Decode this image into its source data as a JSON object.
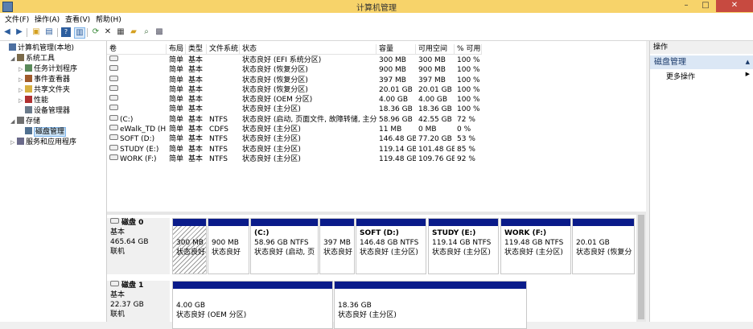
{
  "window": {
    "title": "计算机管理",
    "min": "–",
    "max": "□",
    "close": "✕"
  },
  "menu": [
    "文件(F)",
    "操作(A)",
    "查看(V)",
    "帮助(H)"
  ],
  "toolbar": [
    "back-icon",
    "forward-icon",
    "folder-up-icon",
    "show-hide-tree-icon",
    "help-icon",
    "view-icon",
    "refresh-icon",
    "delete-icon",
    "properties-icon",
    "open-folder-icon",
    "search-icon",
    "settings-icon"
  ],
  "tree": [
    {
      "label": "计算机管理(本地)",
      "level": 0,
      "arrow": "",
      "icon": "computer-icon",
      "color": "#4d6fa0"
    },
    {
      "label": "系统工具",
      "level": 1,
      "arrow": "◢",
      "icon": "tools-icon",
      "color": "#7a6a4a"
    },
    {
      "label": "任务计划程序",
      "level": 2,
      "arrow": "▷",
      "icon": "clock-icon",
      "color": "#5a8a5a"
    },
    {
      "label": "事件查看器",
      "level": 2,
      "arrow": "▷",
      "icon": "event-icon",
      "color": "#a05a2a"
    },
    {
      "label": "共享文件夹",
      "level": 2,
      "arrow": "▷",
      "icon": "share-icon",
      "color": "#d8b040"
    },
    {
      "label": "性能",
      "level": 2,
      "arrow": "▷",
      "icon": "performance-icon",
      "color": "#b03030"
    },
    {
      "label": "设备管理器",
      "level": 2,
      "arrow": "",
      "icon": "device-icon",
      "color": "#6a7a8a"
    },
    {
      "label": "存储",
      "level": 1,
      "arrow": "◢",
      "icon": "storage-icon",
      "color": "#707070"
    },
    {
      "label": "磁盘管理",
      "level": 2,
      "arrow": "",
      "icon": "disk-management-icon",
      "color": "#507090",
      "selected": true
    },
    {
      "label": "服务和应用程序",
      "level": 1,
      "arrow": "▷",
      "icon": "services-icon",
      "color": "#6a6a8a"
    }
  ],
  "volumes": {
    "headers": [
      "卷",
      "布局",
      "类型",
      "文件系统",
      "状态",
      "容量",
      "可用空间",
      "% 可用"
    ],
    "rows": [
      [
        "",
        "简单",
        "基本",
        "",
        "状态良好 (EFI 系统分区)",
        "300 MB",
        "300 MB",
        "100 %"
      ],
      [
        "",
        "简单",
        "基本",
        "",
        "状态良好 (恢复分区)",
        "900 MB",
        "900 MB",
        "100 %"
      ],
      [
        "",
        "简单",
        "基本",
        "",
        "状态良好 (恢复分区)",
        "397 MB",
        "397 MB",
        "100 %"
      ],
      [
        "",
        "简单",
        "基本",
        "",
        "状态良好 (恢复分区)",
        "20.01 GB",
        "20.01 GB",
        "100 %"
      ],
      [
        "",
        "简单",
        "基本",
        "",
        "状态良好 (OEM 分区)",
        "4.00 GB",
        "4.00 GB",
        "100 %"
      ],
      [
        "",
        "简单",
        "基本",
        "",
        "状态良好 (主分区)",
        "18.36 GB",
        "18.36 GB",
        "100 %"
      ],
      [
        "(C:)",
        "简单",
        "基本",
        "NTFS",
        "状态良好 (启动, 页面文件, 故障转储, 主分区)",
        "58.96 GB",
        "42.55 GB",
        "72 %"
      ],
      [
        "eWalk_TD (H:)",
        "简单",
        "基本",
        "CDFS",
        "状态良好 (主分区)",
        "11 MB",
        "0 MB",
        "0 %"
      ],
      [
        "SOFT (D:)",
        "简单",
        "基本",
        "NTFS",
        "状态良好 (主分区)",
        "146.48 GB",
        "77.20 GB",
        "53 %"
      ],
      [
        "STUDY (E:)",
        "简单",
        "基本",
        "NTFS",
        "状态良好 (主分区)",
        "119.14 GB",
        "101.48 GB",
        "85 %"
      ],
      [
        "WORK (F:)",
        "简单",
        "基本",
        "NTFS",
        "状态良好 (主分区)",
        "119.48 GB",
        "109.76 GB",
        "92 %"
      ]
    ]
  },
  "disks": [
    {
      "name": "磁盘 0",
      "type": "基本",
      "size": "465.64 GB",
      "status": "联机",
      "partitions": [
        {
          "label": "",
          "size": "300 MB",
          "status": "状态良好",
          "hatched": true
        },
        {
          "label": "",
          "size": "900 MB",
          "status": "状态良好"
        },
        {
          "label": "(C:)",
          "size": "58.96 GB NTFS",
          "status": "状态良好 (启动, 页"
        },
        {
          "label": "",
          "size": "397 MB",
          "status": "状态良好"
        },
        {
          "label": "SOFT  (D:)",
          "size": "146.48 GB NTFS",
          "status": "状态良好 (主分区)"
        },
        {
          "label": "STUDY  (E:)",
          "size": "119.14 GB NTFS",
          "status": "状态良好 (主分区)"
        },
        {
          "label": "WORK  (F:)",
          "size": "119.48 GB NTFS",
          "status": "状态良好 (主分区)"
        },
        {
          "label": "",
          "size": "20.01 GB",
          "status": "状态良好 (恢复分"
        }
      ]
    },
    {
      "name": "磁盘 1",
      "type": "基本",
      "size": "22.37 GB",
      "status": "联机",
      "partitions": [
        {
          "label": "",
          "size": "4.00 GB",
          "status": "状态良好 (OEM 分区)"
        },
        {
          "label": "",
          "size": "18.36 GB",
          "status": "状态良好 (主分区)"
        }
      ]
    }
  ],
  "actions": {
    "header": "操作",
    "section": "磁盘管理",
    "more": "更多操作",
    "section_arrow": "▲",
    "more_arrow": "▶"
  }
}
